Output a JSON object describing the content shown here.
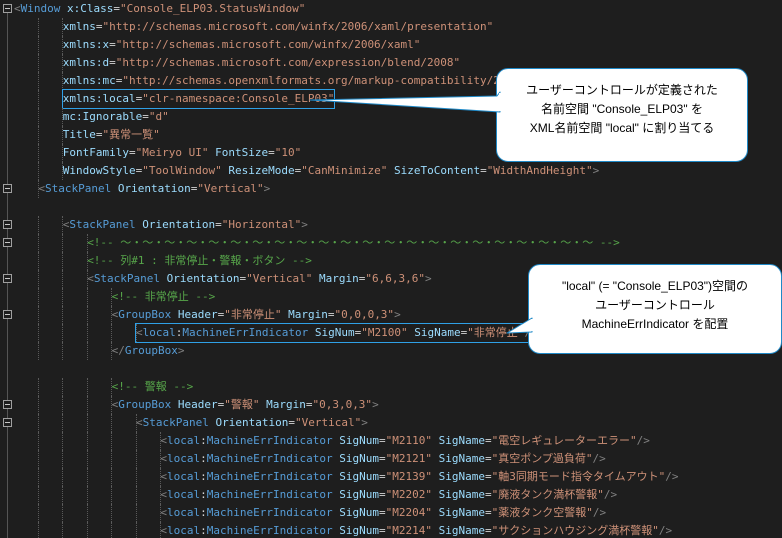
{
  "lines": [
    {
      "fold": true,
      "indent": 0,
      "tokens": [
        [
          "br",
          "<"
        ],
        [
          "el",
          "Window"
        ],
        [
          "pn",
          " "
        ],
        [
          "at",
          "x:Class"
        ],
        [
          "pn",
          "="
        ],
        [
          "st",
          "\"Console_ELP03.StatusWindow\""
        ]
      ]
    },
    {
      "indent": 4,
      "tokens": [
        [
          "at",
          "xmlns"
        ],
        [
          "pn",
          "="
        ],
        [
          "st",
          "\"http://schemas.microsoft.com/winfx/2006/xaml/presentation\""
        ]
      ]
    },
    {
      "indent": 4,
      "tokens": [
        [
          "at",
          "xmlns:x"
        ],
        [
          "pn",
          "="
        ],
        [
          "st",
          "\"http://schemas.microsoft.com/winfx/2006/xaml\""
        ]
      ]
    },
    {
      "indent": 4,
      "tokens": [
        [
          "at",
          "xmlns:d"
        ],
        [
          "pn",
          "="
        ],
        [
          "st",
          "\"http://schemas.microsoft.com/expression/blend/2008\""
        ]
      ]
    },
    {
      "indent": 4,
      "tokens": [
        [
          "at",
          "xmlns:mc"
        ],
        [
          "pn",
          "="
        ],
        [
          "st",
          "\"http://schemas.openxmlformats.org/markup-compatibility/2006\""
        ]
      ]
    },
    {
      "indent": 4,
      "highlight": true,
      "tokens": [
        [
          "at",
          "xmlns:local"
        ],
        [
          "pn",
          "="
        ],
        [
          "st",
          "\"clr-namespace:Console_ELP03\""
        ]
      ]
    },
    {
      "indent": 4,
      "tokens": [
        [
          "at",
          "mc:Ignorable"
        ],
        [
          "pn",
          "="
        ],
        [
          "st",
          "\"d\""
        ]
      ]
    },
    {
      "indent": 4,
      "tokens": [
        [
          "at",
          "Title"
        ],
        [
          "pn",
          "="
        ],
        [
          "st",
          "\"異常一覧\""
        ]
      ]
    },
    {
      "indent": 4,
      "tokens": [
        [
          "at",
          "FontFamily"
        ],
        [
          "pn",
          "="
        ],
        [
          "st",
          "\"Meiryo UI\""
        ],
        [
          "pn",
          " "
        ],
        [
          "at",
          "FontSize"
        ],
        [
          "pn",
          "="
        ],
        [
          "st",
          "\"10\""
        ]
      ]
    },
    {
      "indent": 4,
      "tokens": [
        [
          "at",
          "WindowStyle"
        ],
        [
          "pn",
          "="
        ],
        [
          "st",
          "\"ToolWindow\""
        ],
        [
          "pn",
          " "
        ],
        [
          "at",
          "ResizeMode"
        ],
        [
          "pn",
          "="
        ],
        [
          "st",
          "\"CanMinimize\""
        ],
        [
          "pn",
          " "
        ],
        [
          "at",
          "SizeToContent"
        ],
        [
          "pn",
          "="
        ],
        [
          "st",
          "\"WidthAndHeight\""
        ],
        [
          "br",
          ">"
        ]
      ]
    },
    {
      "fold": true,
      "indent": 2,
      "tokens": [
        [
          "br",
          "<"
        ],
        [
          "el",
          "StackPanel"
        ],
        [
          "pn",
          " "
        ],
        [
          "at",
          "Orientation"
        ],
        [
          "pn",
          "="
        ],
        [
          "st",
          "\"Vertical\""
        ],
        [
          "br",
          ">"
        ]
      ]
    },
    {
      "indent": 0,
      "tokens": []
    },
    {
      "fold": true,
      "indent": 4,
      "tokens": [
        [
          "br",
          "<"
        ],
        [
          "el",
          "StackPanel"
        ],
        [
          "pn",
          " "
        ],
        [
          "at",
          "Orientation"
        ],
        [
          "pn",
          "="
        ],
        [
          "st",
          "\"Horizontal\""
        ],
        [
          "br",
          ">"
        ]
      ]
    },
    {
      "fold": true,
      "indent": 6,
      "tokens": [
        [
          "cm",
          "<!-- ～・～・～・～・～・～・～・～・～・～・～・～・～・～・～・～・～・～・～・～・～・～ -->"
        ]
      ]
    },
    {
      "indent": 6,
      "tokens": [
        [
          "cm",
          "<!-- 列#1 : 非常停止・警報・ボタン -->"
        ]
      ]
    },
    {
      "fold": true,
      "indent": 6,
      "tokens": [
        [
          "br",
          "<"
        ],
        [
          "el",
          "StackPanel"
        ],
        [
          "pn",
          " "
        ],
        [
          "at",
          "Orientation"
        ],
        [
          "pn",
          "="
        ],
        [
          "st",
          "\"Vertical\""
        ],
        [
          "pn",
          " "
        ],
        [
          "at",
          "Margin"
        ],
        [
          "pn",
          "="
        ],
        [
          "st",
          "\"6,6,3,6\""
        ],
        [
          "br",
          ">"
        ]
      ]
    },
    {
      "indent": 8,
      "tokens": [
        [
          "cm",
          "<!-- 非常停止 -->"
        ]
      ]
    },
    {
      "fold": true,
      "indent": 8,
      "tokens": [
        [
          "br",
          "<"
        ],
        [
          "el",
          "GroupBox"
        ],
        [
          "pn",
          " "
        ],
        [
          "at",
          "Header"
        ],
        [
          "pn",
          "="
        ],
        [
          "st",
          "\"非常停止\""
        ],
        [
          "pn",
          " "
        ],
        [
          "at",
          "Margin"
        ],
        [
          "pn",
          "="
        ],
        [
          "st",
          "\"0,0,0,3\""
        ],
        [
          "br",
          ">"
        ]
      ]
    },
    {
      "indent": 10,
      "highlight": true,
      "tokens": [
        [
          "br",
          "<"
        ],
        [
          "ns",
          "local"
        ],
        [
          "pn",
          ":"
        ],
        [
          "el",
          "MachineErrIndicator"
        ],
        [
          "pn",
          " "
        ],
        [
          "at",
          "SigNum"
        ],
        [
          "pn",
          "="
        ],
        [
          "st",
          "\"M2100\""
        ],
        [
          "pn",
          " "
        ],
        [
          "at",
          "SigName"
        ],
        [
          "pn",
          "="
        ],
        [
          "st",
          "\"非常停止\""
        ],
        [
          "br",
          "/>"
        ]
      ]
    },
    {
      "indent": 8,
      "tokens": [
        [
          "br",
          "</"
        ],
        [
          "el",
          "GroupBox"
        ],
        [
          "br",
          ">"
        ]
      ]
    },
    {
      "indent": 0,
      "tokens": []
    },
    {
      "indent": 8,
      "tokens": [
        [
          "cm",
          "<!-- 警報 -->"
        ]
      ]
    },
    {
      "fold": true,
      "indent": 8,
      "tokens": [
        [
          "br",
          "<"
        ],
        [
          "el",
          "GroupBox"
        ],
        [
          "pn",
          " "
        ],
        [
          "at",
          "Header"
        ],
        [
          "pn",
          "="
        ],
        [
          "st",
          "\"警報\""
        ],
        [
          "pn",
          " "
        ],
        [
          "at",
          "Margin"
        ],
        [
          "pn",
          "="
        ],
        [
          "st",
          "\"0,3,0,3\""
        ],
        [
          "br",
          ">"
        ]
      ]
    },
    {
      "fold": true,
      "indent": 10,
      "tokens": [
        [
          "br",
          "<"
        ],
        [
          "el",
          "StackPanel"
        ],
        [
          "pn",
          " "
        ],
        [
          "at",
          "Orientation"
        ],
        [
          "pn",
          "="
        ],
        [
          "st",
          "\"Vertical\""
        ],
        [
          "br",
          ">"
        ]
      ]
    },
    {
      "indent": 12,
      "tokens": [
        [
          "br",
          "<"
        ],
        [
          "ns",
          "local"
        ],
        [
          "pn",
          ":"
        ],
        [
          "el",
          "MachineErrIndicator"
        ],
        [
          "pn",
          " "
        ],
        [
          "at",
          "SigNum"
        ],
        [
          "pn",
          "="
        ],
        [
          "st",
          "\"M2110\""
        ],
        [
          "pn",
          " "
        ],
        [
          "at",
          "SigName"
        ],
        [
          "pn",
          "="
        ],
        [
          "st",
          "\"電空レギュレーターエラー\""
        ],
        [
          "br",
          "/>"
        ]
      ]
    },
    {
      "indent": 12,
      "tokens": [
        [
          "br",
          "<"
        ],
        [
          "ns",
          "local"
        ],
        [
          "pn",
          ":"
        ],
        [
          "el",
          "MachineErrIndicator"
        ],
        [
          "pn",
          " "
        ],
        [
          "at",
          "SigNum"
        ],
        [
          "pn",
          "="
        ],
        [
          "st",
          "\"M2121\""
        ],
        [
          "pn",
          " "
        ],
        [
          "at",
          "SigName"
        ],
        [
          "pn",
          "="
        ],
        [
          "st",
          "\"真空ポンプ過負荷\""
        ],
        [
          "br",
          "/>"
        ]
      ]
    },
    {
      "indent": 12,
      "tokens": [
        [
          "br",
          "<"
        ],
        [
          "ns",
          "local"
        ],
        [
          "pn",
          ":"
        ],
        [
          "el",
          "MachineErrIndicator"
        ],
        [
          "pn",
          " "
        ],
        [
          "at",
          "SigNum"
        ],
        [
          "pn",
          "="
        ],
        [
          "st",
          "\"M2139\""
        ],
        [
          "pn",
          " "
        ],
        [
          "at",
          "SigName"
        ],
        [
          "pn",
          "="
        ],
        [
          "st",
          "\"軸3同期モード指令タイムアウト\""
        ],
        [
          "br",
          "/>"
        ]
      ]
    },
    {
      "indent": 12,
      "tokens": [
        [
          "br",
          "<"
        ],
        [
          "ns",
          "local"
        ],
        [
          "pn",
          ":"
        ],
        [
          "el",
          "MachineErrIndicator"
        ],
        [
          "pn",
          " "
        ],
        [
          "at",
          "SigNum"
        ],
        [
          "pn",
          "="
        ],
        [
          "st",
          "\"M2202\""
        ],
        [
          "pn",
          " "
        ],
        [
          "at",
          "SigName"
        ],
        [
          "pn",
          "="
        ],
        [
          "st",
          "\"廃液タンク満杯警報\""
        ],
        [
          "br",
          "/>"
        ]
      ]
    },
    {
      "indent": 12,
      "tokens": [
        [
          "br",
          "<"
        ],
        [
          "ns",
          "local"
        ],
        [
          "pn",
          ":"
        ],
        [
          "el",
          "MachineErrIndicator"
        ],
        [
          "pn",
          " "
        ],
        [
          "at",
          "SigNum"
        ],
        [
          "pn",
          "="
        ],
        [
          "st",
          "\"M2204\""
        ],
        [
          "pn",
          " "
        ],
        [
          "at",
          "SigName"
        ],
        [
          "pn",
          "="
        ],
        [
          "st",
          "\"薬液タンク空警報\""
        ],
        [
          "br",
          "/>"
        ]
      ]
    },
    {
      "indent": 12,
      "tokens": [
        [
          "br",
          "<"
        ],
        [
          "ns",
          "local"
        ],
        [
          "pn",
          ":"
        ],
        [
          "el",
          "MachineErrIndicator"
        ],
        [
          "pn",
          " "
        ],
        [
          "at",
          "SigNum"
        ],
        [
          "pn",
          "="
        ],
        [
          "st",
          "\"M2214\""
        ],
        [
          "pn",
          " "
        ],
        [
          "at",
          "SigName"
        ],
        [
          "pn",
          "="
        ],
        [
          "st",
          "\"サクションハウジング満杯警報\""
        ],
        [
          "br",
          "/>"
        ]
      ]
    }
  ],
  "callouts": [
    {
      "lines": [
        "ユーザーコントロールが定義された",
        "名前空間 \"Console_ELP03\" を",
        "XML名前空間 \"local\" に割り当てる"
      ]
    },
    {
      "lines": [
        "\"local\" (= \"Console_ELP03\")空間の",
        "ユーザーコントロール",
        "MachineErrIndicator を配置"
      ]
    }
  ],
  "colors": {
    "background": "#1e1e1e",
    "element": "#569cd6",
    "attribute": "#9cdcfe",
    "string": "#ce9178",
    "comment": "#57a64a",
    "bracket": "#808080",
    "highlight_box": "#2fa0e6",
    "callout_border": "#1f89c7"
  }
}
